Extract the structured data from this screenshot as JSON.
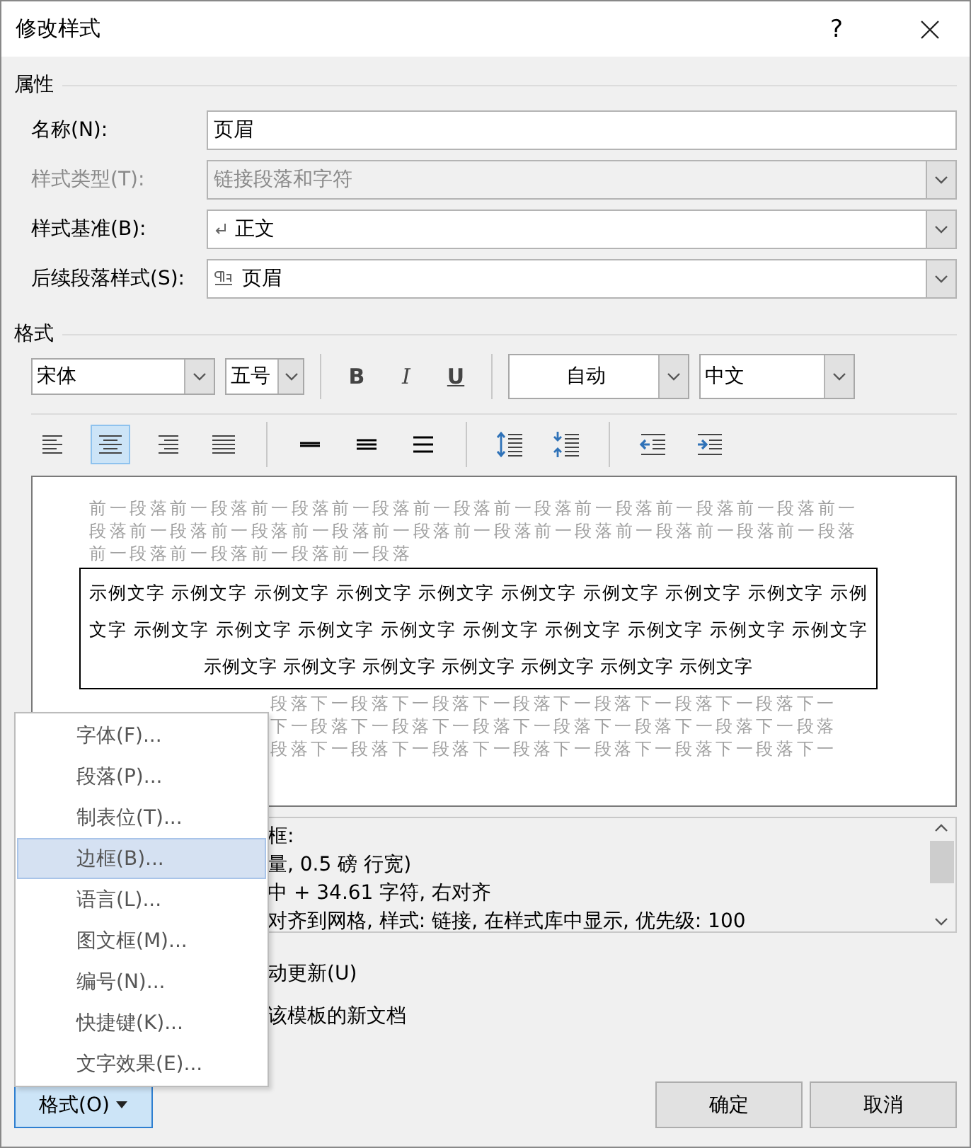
{
  "window": {
    "title": "修改样式",
    "help": "?"
  },
  "properties": {
    "heading": "属性",
    "fields": [
      {
        "label": "名称(N):",
        "kind": "text",
        "value": "页眉",
        "disabled": false
      },
      {
        "label": "样式类型(T):",
        "kind": "combo",
        "value": "链接段落和字符",
        "disabled": true
      },
      {
        "label": "样式基准(B):",
        "kind": "combo",
        "value": "正文",
        "disabled": false
      },
      {
        "label": "后续段落样式(S):",
        "kind": "combo",
        "value": "页眉",
        "disabled": false
      }
    ]
  },
  "format": {
    "heading": "格式",
    "font": "宋体",
    "size": "五号",
    "styles": [
      {
        "label": "B",
        "kind": "bold"
      },
      {
        "label": "I",
        "kind": "italic"
      },
      {
        "label": "U",
        "kind": "underline"
      }
    ],
    "swatch_label": "自动",
    "script": "中文",
    "paragraph_groups": [
      [
        {
          "kind": "align-left",
          "selected": false
        },
        {
          "kind": "align-center",
          "selected": true
        },
        {
          "kind": "align-right",
          "selected": false
        },
        {
          "kind": "justify",
          "selected": false
        }
      ],
      [
        {
          "kind": "single-spacing",
          "selected": false
        },
        {
          "kind": "one-half-spacing",
          "selected": false
        },
        {
          "kind": "double-spacing",
          "selected": false
        }
      ],
      [
        {
          "kind": "space-before",
          "selected": false
        },
        {
          "kind": "space-after",
          "selected": false
        }
      ],
      [
        {
          "kind": "indent-decrease",
          "selected": false
        },
        {
          "kind": "indent-increase",
          "selected": false
        }
      ]
    ]
  },
  "preview": {
    "previous_lines": [
      "前一段落前一段落前一段落前一段落前一段落前一段落前一段落前一段落前一段落前一",
      "段落前一段落前一段落前一段落前一段落前一段落前一段落前一段落前一段落前一段落",
      "前一段落前一段落前一段落前一段落"
    ],
    "sample_lines": [
      "示例文字 示例文字 示例文字 示例文字 示例文字 示例文字 示例文字 示例文字 示例文字 示例",
      "文字 示例文字 示例文字 示例文字 示例文字 示例文字 示例文字 示例文字 示例文字 示例文字",
      "示例文字 示例文字 示例文字 示例文字 示例文字 示例文字 示例文字"
    ],
    "following_lines": [
      "段落下一段落下一段落下一段落下一段落下一段落下一段落下一",
      "下一段落下一段落下一段落下一段落下一段落下一段落下一段落",
      "段落下一段落下一段落下一段落下一段落下一段落下一段落下一"
    ]
  },
  "description": {
    "lines": [
      "框:",
      "量, 0.5 磅 行宽)",
      "中 +  34.61 字符, 右对齐",
      "对齐到网格, 样式: 链接, 在样式库中显示, 优先级: 100"
    ]
  },
  "options": [
    {
      "label": "动更新(U)"
    },
    {
      "label": "该模板的新文档"
    }
  ],
  "menu": {
    "items": [
      {
        "label": "字体(F)...",
        "selected": false
      },
      {
        "label": "段落(P)...",
        "selected": false
      },
      {
        "label": "制表位(T)...",
        "selected": false
      },
      {
        "label": "边框(B)...",
        "selected": true
      },
      {
        "label": "语言(L)...",
        "selected": false
      },
      {
        "label": "图文框(M)...",
        "selected": false
      },
      {
        "label": "编号(N)...",
        "selected": false
      },
      {
        "label": "快捷键(K)...",
        "selected": false
      },
      {
        "label": "文字效果(E)...",
        "selected": false
      }
    ]
  },
  "format_button": {
    "label": "格式(O)",
    "pressed": true
  },
  "buttons": [
    "确定",
    "取消"
  ]
}
